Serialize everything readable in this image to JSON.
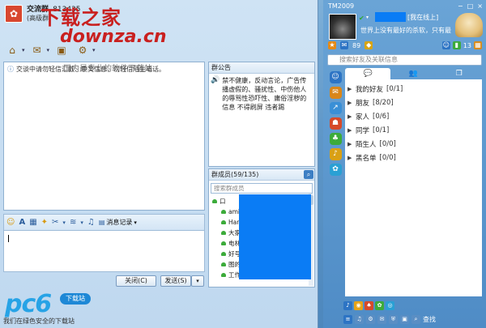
{
  "chat": {
    "group_name": "交流群",
    "group_id_partial": "813435",
    "group_level": "(高级群)",
    "watermark_top": "下载之家",
    "watermark_url": "downza.cn",
    "watermark_sub": "国内最专业的软件下载站",
    "notice": "交谈中请勿轻信汇款、中奖信息，勿轻信陌生电话。",
    "edit_history": "消息记录",
    "close_label": "关闭(C)",
    "send_label": "发送(S)",
    "send_more": "▾"
  },
  "bulletin": {
    "title": "群公告",
    "text": "禁不健康，反动言论，广告传播虚假的、骚扰性、中伤他人的辱骂性恐吓性、庸俗淫秽的信息  不得刷屏  违者踢"
  },
  "members": {
    "title": "群成员(59/135)",
    "search_placeholder": "搜索群成员",
    "items": [
      "口",
      "ami",
      "Har",
      "大家",
      "电林",
      "好号",
      "图的",
      "工作"
    ]
  },
  "pc6": {
    "logo": "pc6",
    "tag": "下载站",
    "sub": "我们在绿色安全的下载站"
  },
  "tm": {
    "title": "TM2009",
    "window_buttons": [
      "−",
      "□",
      "×"
    ],
    "status": "[我在线上]",
    "signature": "世界上没有最好的杀软，只有最...",
    "mail_count": "89",
    "count_right": "13",
    "search_placeholder": "搜索好友及关联信息",
    "tabs": [
      "💬",
      "👥",
      "❐"
    ],
    "groups": [
      {
        "name": "我的好友",
        "count": "[0/1]"
      },
      {
        "name": "朋友",
        "count": "[8/20]"
      },
      {
        "name": "家人",
        "count": "[0/6]"
      },
      {
        "name": "同学",
        "count": "[0/1]"
      },
      {
        "name": "陌生人",
        "count": "[0/0]"
      },
      {
        "name": "黑名单",
        "count": "[0/0]"
      }
    ],
    "find_label": "查找"
  }
}
